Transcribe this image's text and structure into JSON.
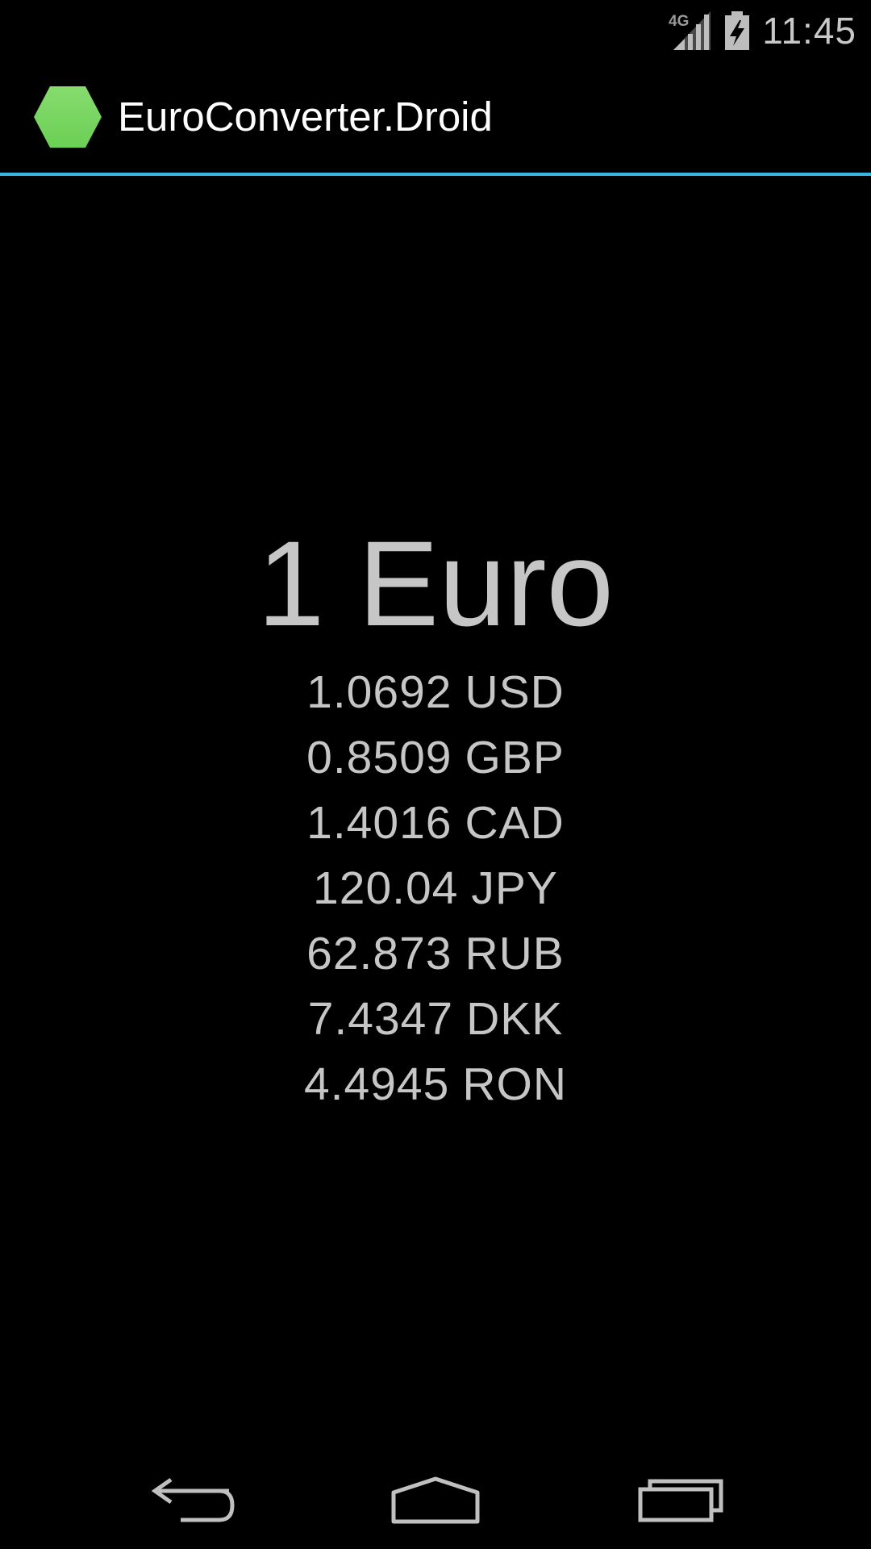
{
  "status_bar": {
    "network_type": "4G",
    "network_icon": "signal-4g-icon",
    "battery_icon": "battery-charging-icon",
    "time": "11:45"
  },
  "action_bar": {
    "app_icon": "hexagon-app-icon",
    "title": "EuroConverter.Droid",
    "divider_color": "#33b5e5"
  },
  "converter": {
    "base_amount": "1 Euro",
    "rates": [
      {
        "value": "1.0692",
        "currency": "USD"
      },
      {
        "value": "0.8509",
        "currency": "GBP"
      },
      {
        "value": "1.4016",
        "currency": "CAD"
      },
      {
        "value": "120.04",
        "currency": "JPY"
      },
      {
        "value": "62.873",
        "currency": "RUB"
      },
      {
        "value": "7.4347",
        "currency": "DKK"
      },
      {
        "value": "4.4945",
        "currency": "RON"
      }
    ]
  },
  "nav_bar": {
    "back_icon": "back-arrow-icon",
    "home_icon": "home-icon",
    "recents_icon": "recent-apps-icon"
  },
  "colors": {
    "background": "#000000",
    "accent": "#33b5e5",
    "app_icon_green": "#76d65e",
    "text_primary": "#ffffff",
    "text_secondary": "#c6c6c6"
  }
}
